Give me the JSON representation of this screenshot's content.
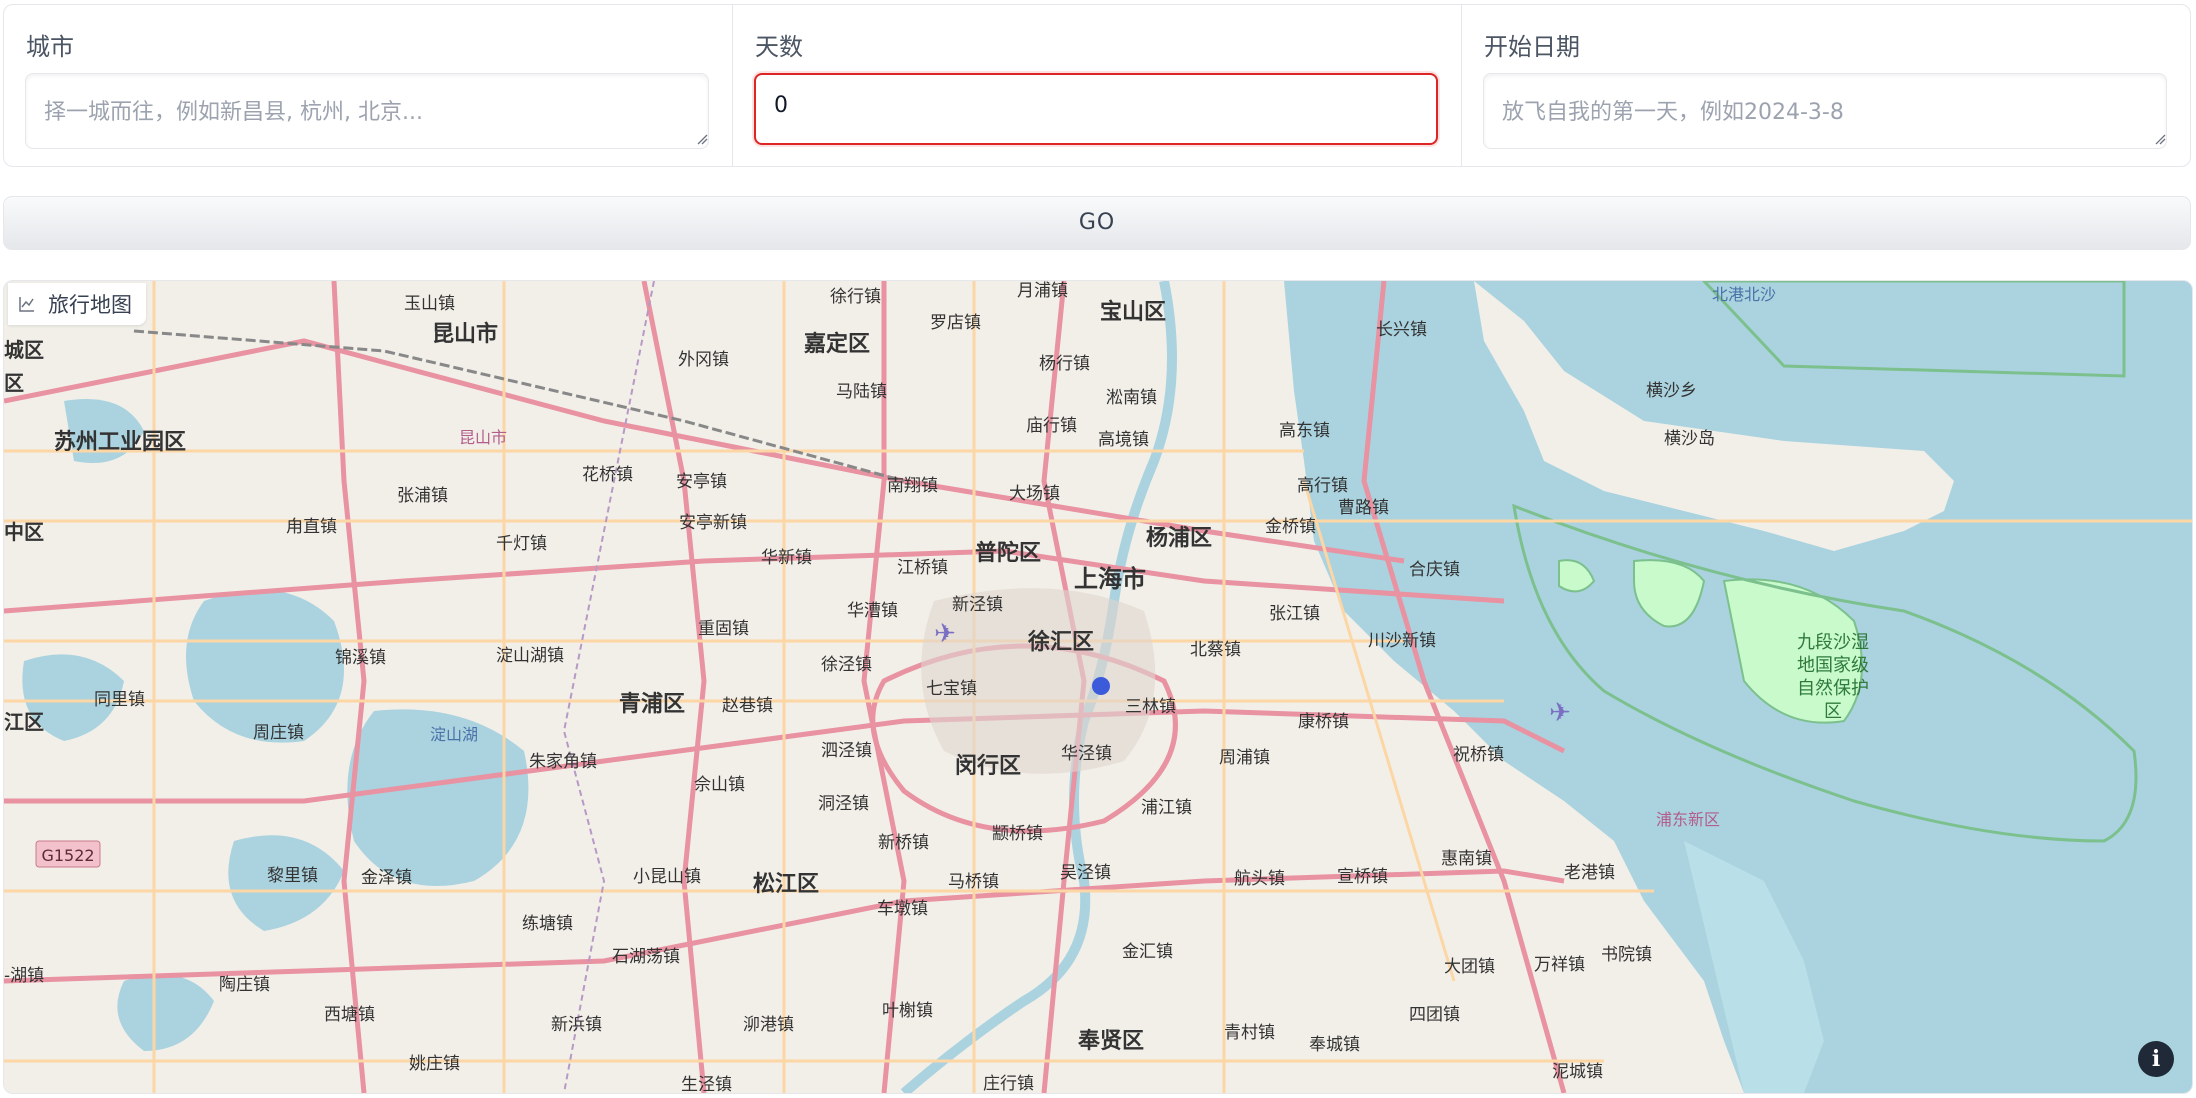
{
  "form": {
    "city": {
      "label": "城市",
      "placeholder": "择一城而往，例如新昌县, 杭州, 北京..."
    },
    "days": {
      "label": "天数",
      "value": "0"
    },
    "start_date": {
      "label": "开始日期",
      "placeholder": "放飞自我的第一天，例如2024-3-8"
    }
  },
  "go_button": "GO",
  "map": {
    "label": "旅行地图",
    "info_icon": "info-icon",
    "colors": {
      "water": "#aad3df",
      "land": "#f2efe9",
      "motorway": "#e892a2",
      "primary": "#fcd6a4",
      "park": "#c8facc"
    },
    "places": {
      "yushan": "玉山镇",
      "xuhang": "徐行镇",
      "yuepu": "月浦镇",
      "baoshan": "宝山区",
      "beigang": "北港北沙",
      "kunshan": "昆山市",
      "jiading": "嘉定区",
      "luodian": "罗店镇",
      "changxing": "长兴镇",
      "chengqu": "城区",
      "waigang": "外冈镇",
      "yanghang": "杨行镇",
      "hengsha_x": "横沙乡",
      "hengsha_d": "横沙岛",
      "qu": "区",
      "malu": "马陆镇",
      "miaohang": "庙行镇",
      "songnan": "淞南镇",
      "gaodong": "高东镇",
      "suzhou_park": "苏州工业园区",
      "kunshan_small": "昆山市",
      "huaqiao": "花桥镇",
      "anting": "安亭镇",
      "gaojing": "高境镇",
      "zhangpu": "张浦镇",
      "nanxiang": "南翔镇",
      "dachang": "大场镇",
      "gaohang": "高行镇",
      "zhongqu": "中区",
      "zhixu": "甪直镇",
      "qiandeng": "千灯镇",
      "antingxin": "安亭新镇",
      "putuo": "普陀区",
      "yangpu": "杨浦区",
      "jinqiao": "金桥镇",
      "caolu": "曹路镇",
      "huaxin": "华新镇",
      "jiangqiao": "江桥镇",
      "shanghai": "上海市",
      "heqing": "合庆镇",
      "huacao": "华漕镇",
      "xinjing": "新泾镇",
      "zhangjiang": "张江镇",
      "jinxi": "锦溪镇",
      "dianshanhu_town": "淀山湖镇",
      "chonggu": "重固镇",
      "xuhui": "徐汇区",
      "beicai": "北蔡镇",
      "chuansha": "川沙新镇",
      "jiuduan": "九段沙湿地国家级自然保护区",
      "tongli": "同里镇",
      "xujing": "徐泾镇",
      "qibao": "七宝镇",
      "jiang": "江区",
      "zhouzhuang": "周庄镇",
      "qingpu": "青浦区",
      "zhaoxiang": "赵巷镇",
      "sanlin": "三林镇",
      "dianshanhu": "淀山湖",
      "kangqiao": "康桥镇",
      "zhujiajiao": "朱家角镇",
      "sijing": "泗泾镇",
      "huajing": "华泾镇",
      "zhoupu": "周浦镇",
      "zhuqiao": "祝桥镇",
      "minhang": "闵行区",
      "yushan2": "佘山镇",
      "dongjing": "洞泾镇",
      "pujiang": "浦江镇",
      "pudong": "浦东新区",
      "g1522": "G1522",
      "xinqiao": "新桥镇",
      "zhuanqiao": "颛桥镇",
      "lili": "黎里镇",
      "jinze": "金泽镇",
      "xiaokunshan": "小昆山镇",
      "songjiang": "松江区",
      "majiao": "马桥镇",
      "wujing": "吴泾镇",
      "hangtou": "航头镇",
      "xuanqiao": "宣桥镇",
      "huinan": "惠南镇",
      "laogang": "老港镇",
      "chedun": "车墩镇",
      "liantang": "练塘镇",
      "jinhui": "金汇镇",
      "shuyuan": "书院镇",
      "shihudang": "石湖荡镇",
      "datuan": "大团镇",
      "wanxiang": "万祥镇",
      "ye": "-湖镇",
      "taozhuang": "陶庄镇",
      "yexie": "叶榭镇",
      "xitang": "西塘镇",
      "xinbang": "新浜镇",
      "pangang": "泖港镇",
      "situan": "四团镇",
      "fengxian": "奉贤区",
      "qingcun": "青村镇",
      "fengcheng": "奉城镇",
      "yaozhuang": "姚庄镇",
      "shengjing": "生泾镇",
      "zhuanghang": "庄行镇",
      "nicheng": "泥城镇"
    }
  }
}
